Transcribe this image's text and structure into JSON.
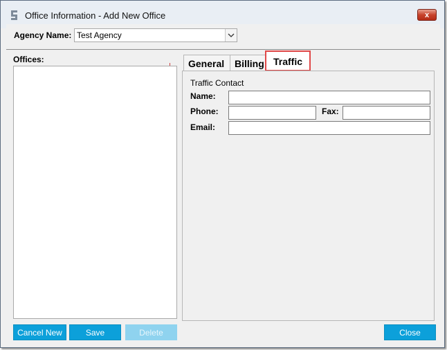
{
  "window": {
    "title": "Office Information - Add New Office",
    "close_glyph": "x"
  },
  "agency": {
    "label": "Agency Name:",
    "value": "Test Agency"
  },
  "offices": {
    "label": "Offices:",
    "items": []
  },
  "tabs": [
    {
      "label": "General",
      "selected": false
    },
    {
      "label": "Billing",
      "selected": false
    },
    {
      "label": "Traffic",
      "selected": true
    }
  ],
  "traffic_contact": {
    "group_title": "Traffic Contact",
    "name_label": "Name:",
    "name_value": "",
    "phone_label": "Phone:",
    "phone_value": "",
    "fax_label": "Fax:",
    "fax_value": "",
    "email_label": "Email:",
    "email_value": ""
  },
  "buttons": {
    "cancel_new": "Cancel New",
    "save": "Save",
    "delete": "Delete",
    "close": "Close"
  },
  "colors": {
    "button_accent": "#0ca0da",
    "tab_highlight": "#e04848"
  }
}
